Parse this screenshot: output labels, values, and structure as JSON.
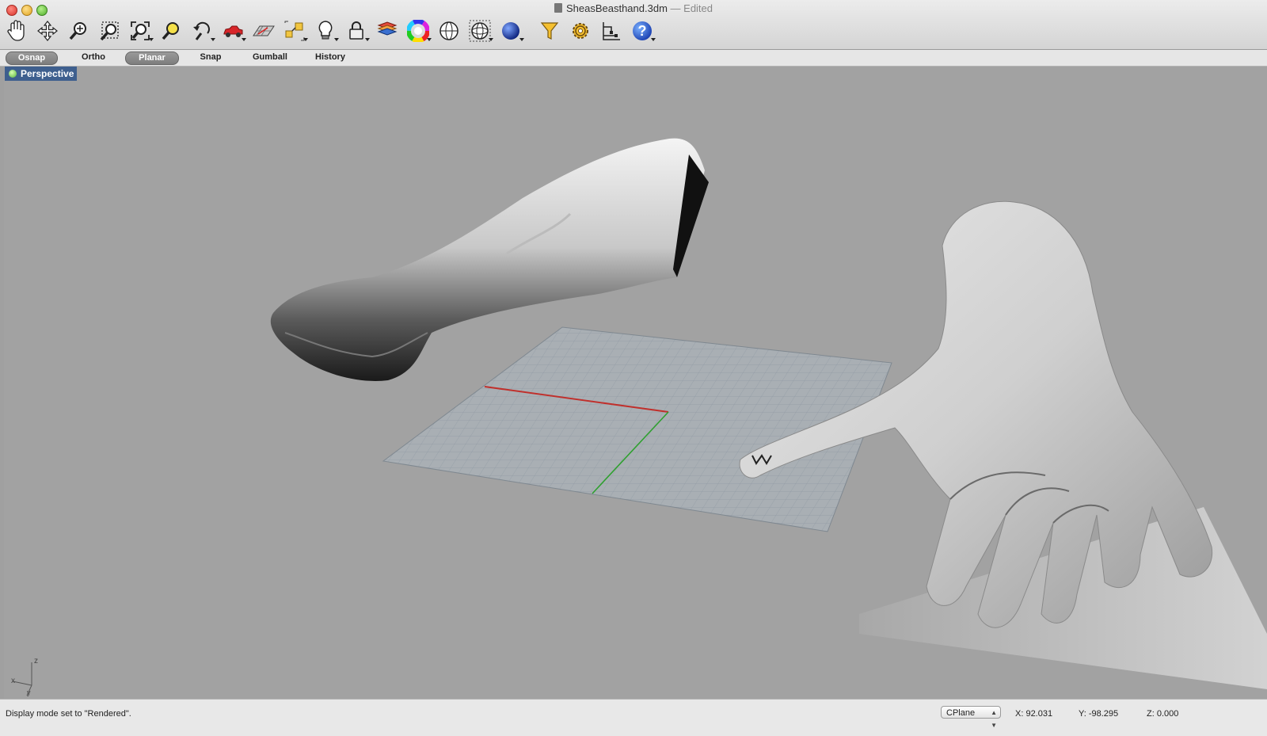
{
  "window": {
    "title": "SheasBeasthand.3dm",
    "edited": "— Edited"
  },
  "toolbar": {
    "icons": [
      "pan-icon",
      "rotate-view-icon",
      "zoom-icon",
      "zoom-window-icon",
      "zoom-extents-icon",
      "zoom-selected-icon",
      "undo-view-icon",
      "car-icon",
      "grid-plane-icon",
      "transform-icon",
      "light-bulb-icon",
      "lock-icon",
      "layer-book-icon",
      "color-wheel-icon",
      "sphere-wireframe-icon",
      "globe-icon",
      "render-sphere-icon",
      "funnel-icon",
      "gear-settings-icon",
      "properties-icon",
      "help-icon"
    ]
  },
  "modes": {
    "osnap": "Osnap",
    "ortho": "Ortho",
    "planar": "Planar",
    "snap": "Snap",
    "gumball": "Gumball",
    "history": "History"
  },
  "viewport": {
    "label": "Perspective",
    "axis_z": "z",
    "axis_x": "x",
    "axis_y": "y"
  },
  "status": {
    "message": "Display mode set to \"Rendered\".",
    "cplane": "CPlane",
    "x": "X: 92.031",
    "y": "Y: -98.295",
    "z": "Z: 0.000"
  }
}
